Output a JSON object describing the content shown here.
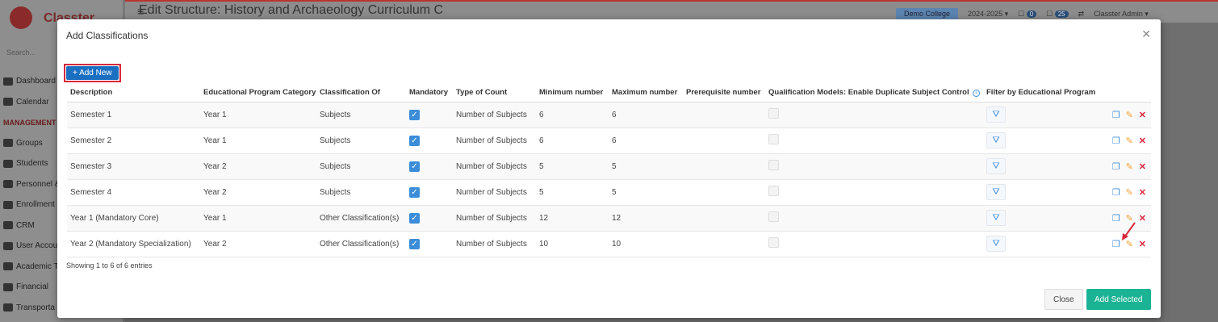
{
  "app": {
    "logo_text": "Classter",
    "search_placeholder": "Search..."
  },
  "page": {
    "title": "Edit Structure: History and Archaeology Curriculum C"
  },
  "topbar": {
    "college": "Demo College",
    "year": "2024-2025",
    "badge_1": "0",
    "badge_2": "25",
    "user": "Classter Admin"
  },
  "sidebar": {
    "items": [
      {
        "label": "Dashboard"
      },
      {
        "label": "Calendar"
      },
      {
        "label": "MANAGEMENT",
        "section": true
      },
      {
        "label": "Groups"
      },
      {
        "label": "Students"
      },
      {
        "label": "Personnel &"
      },
      {
        "label": "Enrollment"
      },
      {
        "label": "CRM"
      },
      {
        "label": "User Accou"
      },
      {
        "label": "Academic T"
      },
      {
        "label": "Financial"
      },
      {
        "label": "Transporta"
      }
    ]
  },
  "modal": {
    "title": "Add Classifications",
    "add_new_label": "+ Add New",
    "columns": [
      "Description",
      "Educational Program Category",
      "Classification Of",
      "Mandatory",
      "Type of Count",
      "Minimum number",
      "Maximum number",
      "Prerequisite number",
      "Qualification Models: Enable Duplicate Subject Control",
      "Filter by Educational Program",
      ""
    ],
    "rows": [
      {
        "description": "Semester 1",
        "category": "Year 1",
        "classification_of": "Subjects",
        "mandatory": true,
        "type_of_count": "Number of Subjects",
        "min": "6",
        "max": "6",
        "prereq": ""
      },
      {
        "description": "Semester 2",
        "category": "Year 1",
        "classification_of": "Subjects",
        "mandatory": true,
        "type_of_count": "Number of Subjects",
        "min": "6",
        "max": "6",
        "prereq": ""
      },
      {
        "description": "Semester 3",
        "category": "Year 2",
        "classification_of": "Subjects",
        "mandatory": true,
        "type_of_count": "Number of Subjects",
        "min": "5",
        "max": "5",
        "prereq": ""
      },
      {
        "description": "Semester 4",
        "category": "Year 2",
        "classification_of": "Subjects",
        "mandatory": true,
        "type_of_count": "Number of Subjects",
        "min": "5",
        "max": "5",
        "prereq": ""
      },
      {
        "description": "Year 1 (Mandatory Core)",
        "category": "Year 1",
        "classification_of": "Other Classification(s)",
        "mandatory": true,
        "type_of_count": "Number of Subjects",
        "min": "12",
        "max": "12",
        "prereq": ""
      },
      {
        "description": "Year 2 (Mandatory Specialization)",
        "category": "Year 2",
        "classification_of": "Other Classification(s)",
        "mandatory": true,
        "type_of_count": "Number of Subjects",
        "min": "10",
        "max": "10",
        "prereq": ""
      }
    ],
    "showing_text": "Showing 1 to 6 of 6 entries",
    "close_label": "Close",
    "add_selected_label": "Add Selected"
  },
  "colors": {
    "primary": "#1a6fc1",
    "success": "#1ab394",
    "danger": "#d9263b",
    "edit": "#f0a030"
  }
}
